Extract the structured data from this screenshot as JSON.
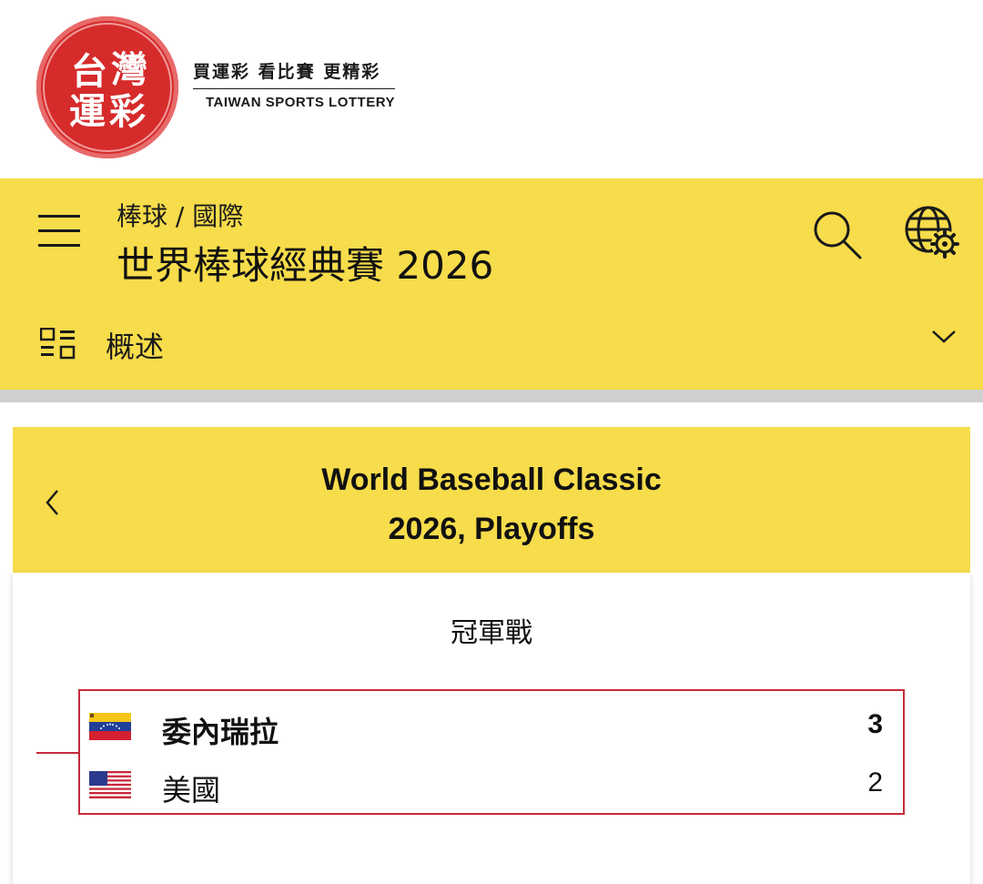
{
  "logo": {
    "seal_text": [
      "台",
      "灣",
      "運",
      "彩"
    ],
    "slogan": "買運彩  看比賽  更精彩",
    "english": "TAIWAN SPORTS LOTTERY"
  },
  "header": {
    "breadcrumb": "棒球 / 國際",
    "title": "世界棒球經典賽 2026",
    "section_label": "概述"
  },
  "card": {
    "title_line1": "World Baseball Classic",
    "title_line2": "2026, Playoffs",
    "round_label": "冠軍戰",
    "match": {
      "home": {
        "name": "委內瑞拉",
        "score": "3",
        "flag": "venezuela-flag-icon",
        "winner": true
      },
      "away": {
        "name": "美國",
        "score": "2",
        "flag": "usa-flag-icon",
        "winner": false
      }
    }
  },
  "colors": {
    "brand_yellow": "#f7dc4b",
    "seal_red": "#d62b2b",
    "bracket_red": "#c62a3b"
  }
}
